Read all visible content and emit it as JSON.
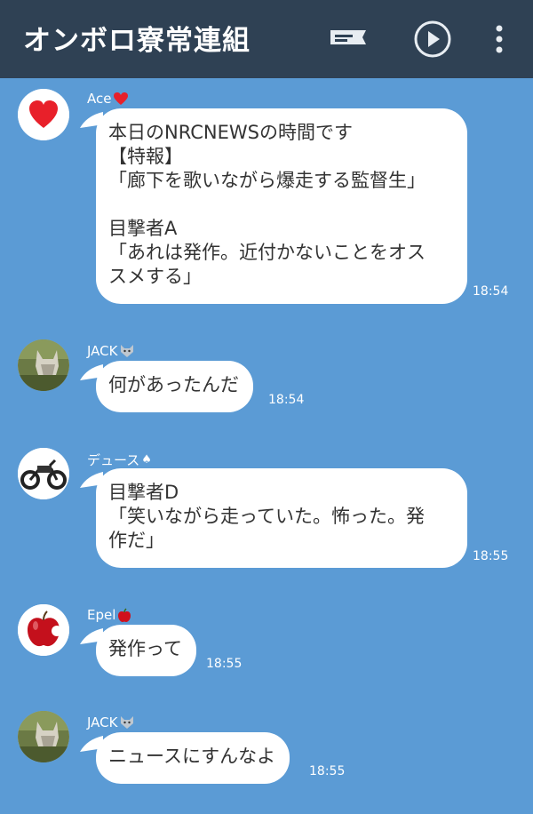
{
  "header": {
    "title": "オンボロ寮常連組",
    "icons": [
      "notes-icon",
      "play-icon",
      "more-icon"
    ]
  },
  "messages": [
    {
      "sender": "Ace",
      "sender_emoji": "heart",
      "avatar": "heart-avatar",
      "text": "本日のNRCNEWSの時間です\n【特報】\n「廊下を歌いながら爆走する監督生」\n\n目撃者A\n「あれは発作。近付かないことをオス\nスメする」",
      "time": "18:54"
    },
    {
      "sender": "JACK",
      "sender_emoji": "wolf",
      "avatar": "wolf-avatar",
      "text": "何があったんだ",
      "time": "18:54"
    },
    {
      "sender": "デュース",
      "sender_emoji": "spade",
      "avatar": "motorcycle-avatar",
      "text": "目撃者D\n「笑いながら走っていた。怖った。発\n作だ」",
      "time": "18:55"
    },
    {
      "sender": "Epel",
      "sender_emoji": "apple",
      "avatar": "apple-avatar",
      "text": "発作って",
      "time": "18:55"
    },
    {
      "sender": "JACK",
      "sender_emoji": "wolf",
      "avatar": "wolf-avatar",
      "text": "ニュースにすんなよ",
      "time": "18:55"
    }
  ],
  "colors": {
    "header_bg": "#2f4154",
    "chat_bg": "#5b9bd5",
    "bubble_bg": "#ffffff",
    "heart": "#e8202a"
  }
}
